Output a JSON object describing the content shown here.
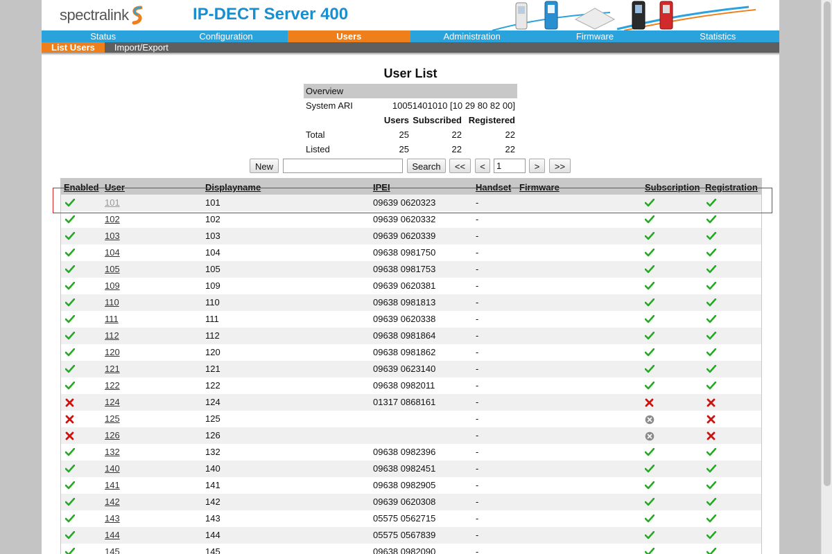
{
  "header": {
    "logo_text": "spectralink",
    "title": "IP-DECT Server 400"
  },
  "nav": {
    "tabs": [
      "Status",
      "Configuration",
      "Users",
      "Administration",
      "Firmware",
      "Statistics"
    ],
    "active": "Users"
  },
  "subnav": {
    "tabs": [
      "List Users",
      "Import/Export"
    ],
    "active": "List Users"
  },
  "page_title": "User List",
  "overview": {
    "heading": "Overview",
    "system_ari_label": "System ARI",
    "system_ari_value": "10051401010 [10 29 80 82 00]",
    "col_users": "Users",
    "col_subscribed": "Subscribed",
    "col_registered": "Registered",
    "total_label": "Total",
    "total": {
      "users": "25",
      "subscribed": "22",
      "registered": "22"
    },
    "listed_label": "Listed",
    "listed": {
      "users": "25",
      "subscribed": "22",
      "registered": "22"
    }
  },
  "search": {
    "new_label": "New",
    "query": "",
    "search_label": "Search",
    "first_label": "<<",
    "prev_label": "<",
    "page": "1",
    "next_label": ">",
    "last_label": ">>"
  },
  "table": {
    "headers": {
      "enabled": "Enabled",
      "user": "User",
      "displayname": "Displayname",
      "ipei": "IPEI",
      "handset": "Handset",
      "firmware": "Firmware",
      "subscription": "Subscription",
      "registration": "Registration"
    },
    "rows": [
      {
        "enabled": "check",
        "user": "101",
        "displayname": "101",
        "ipei": "09639 0620323",
        "handset": "-",
        "firmware": "",
        "subscription": "check",
        "registration": "check"
      },
      {
        "enabled": "check",
        "user": "102",
        "displayname": "102",
        "ipei": "09639 0620332",
        "handset": "-",
        "firmware": "",
        "subscription": "check",
        "registration": "check"
      },
      {
        "enabled": "check",
        "user": "103",
        "displayname": "103",
        "ipei": "09639 0620339",
        "handset": "-",
        "firmware": "",
        "subscription": "check",
        "registration": "check"
      },
      {
        "enabled": "check",
        "user": "104",
        "displayname": "104",
        "ipei": "09638 0981750",
        "handset": "-",
        "firmware": "",
        "subscription": "check",
        "registration": "check"
      },
      {
        "enabled": "check",
        "user": "105",
        "displayname": "105",
        "ipei": "09638 0981753",
        "handset": "-",
        "firmware": "",
        "subscription": "check",
        "registration": "check"
      },
      {
        "enabled": "check",
        "user": "109",
        "displayname": "109",
        "ipei": "09639 0620381",
        "handset": "-",
        "firmware": "",
        "subscription": "check",
        "registration": "check"
      },
      {
        "enabled": "check",
        "user": "110",
        "displayname": "110",
        "ipei": "09638 0981813",
        "handset": "-",
        "firmware": "",
        "subscription": "check",
        "registration": "check"
      },
      {
        "enabled": "check",
        "user": "111",
        "displayname": "111",
        "ipei": "09639 0620338",
        "handset": "-",
        "firmware": "",
        "subscription": "check",
        "registration": "check"
      },
      {
        "enabled": "check",
        "user": "112",
        "displayname": "112",
        "ipei": "09638 0981864",
        "handset": "-",
        "firmware": "",
        "subscription": "check",
        "registration": "check"
      },
      {
        "enabled": "check",
        "user": "120",
        "displayname": "120",
        "ipei": "09638 0981862",
        "handset": "-",
        "firmware": "",
        "subscription": "check",
        "registration": "check"
      },
      {
        "enabled": "check",
        "user": "121",
        "displayname": "121",
        "ipei": "09639 0623140",
        "handset": "-",
        "firmware": "",
        "subscription": "check",
        "registration": "check"
      },
      {
        "enabled": "check",
        "user": "122",
        "displayname": "122",
        "ipei": "09638 0982011",
        "handset": "-",
        "firmware": "",
        "subscription": "check",
        "registration": "check"
      },
      {
        "enabled": "cross",
        "user": "124",
        "displayname": "124",
        "ipei": "01317 0868161",
        "handset": "-",
        "firmware": "",
        "subscription": "cross",
        "registration": "cross"
      },
      {
        "enabled": "cross",
        "user": "125",
        "displayname": "125",
        "ipei": "",
        "handset": "-",
        "firmware": "",
        "subscription": "none",
        "registration": "cross"
      },
      {
        "enabled": "cross",
        "user": "126",
        "displayname": "126",
        "ipei": "",
        "handset": "-",
        "firmware": "",
        "subscription": "none",
        "registration": "cross"
      },
      {
        "enabled": "check",
        "user": "132",
        "displayname": "132",
        "ipei": "09638 0982396",
        "handset": "-",
        "firmware": "",
        "subscription": "check",
        "registration": "check"
      },
      {
        "enabled": "check",
        "user": "140",
        "displayname": "140",
        "ipei": "09638 0982451",
        "handset": "-",
        "firmware": "",
        "subscription": "check",
        "registration": "check"
      },
      {
        "enabled": "check",
        "user": "141",
        "displayname": "141",
        "ipei": "09638 0982905",
        "handset": "-",
        "firmware": "",
        "subscription": "check",
        "registration": "check"
      },
      {
        "enabled": "check",
        "user": "142",
        "displayname": "142",
        "ipei": "09639 0620308",
        "handset": "-",
        "firmware": "",
        "subscription": "check",
        "registration": "check"
      },
      {
        "enabled": "check",
        "user": "143",
        "displayname": "143",
        "ipei": "05575 0562715",
        "handset": "-",
        "firmware": "",
        "subscription": "check",
        "registration": "check"
      },
      {
        "enabled": "check",
        "user": "144",
        "displayname": "144",
        "ipei": "05575 0567839",
        "handset": "-",
        "firmware": "",
        "subscription": "check",
        "registration": "check"
      },
      {
        "enabled": "check",
        "user": "145",
        "displayname": "145",
        "ipei": "09638 0982090",
        "handset": "-",
        "firmware": "",
        "subscription": "check",
        "registration": "check"
      }
    ]
  },
  "colors": {
    "nav_blue": "#2aa3dd",
    "active_orange": "#ef7f1a",
    "check_green": "#22aa22",
    "cross_red": "#cc1111",
    "highlight": "#e02020"
  }
}
